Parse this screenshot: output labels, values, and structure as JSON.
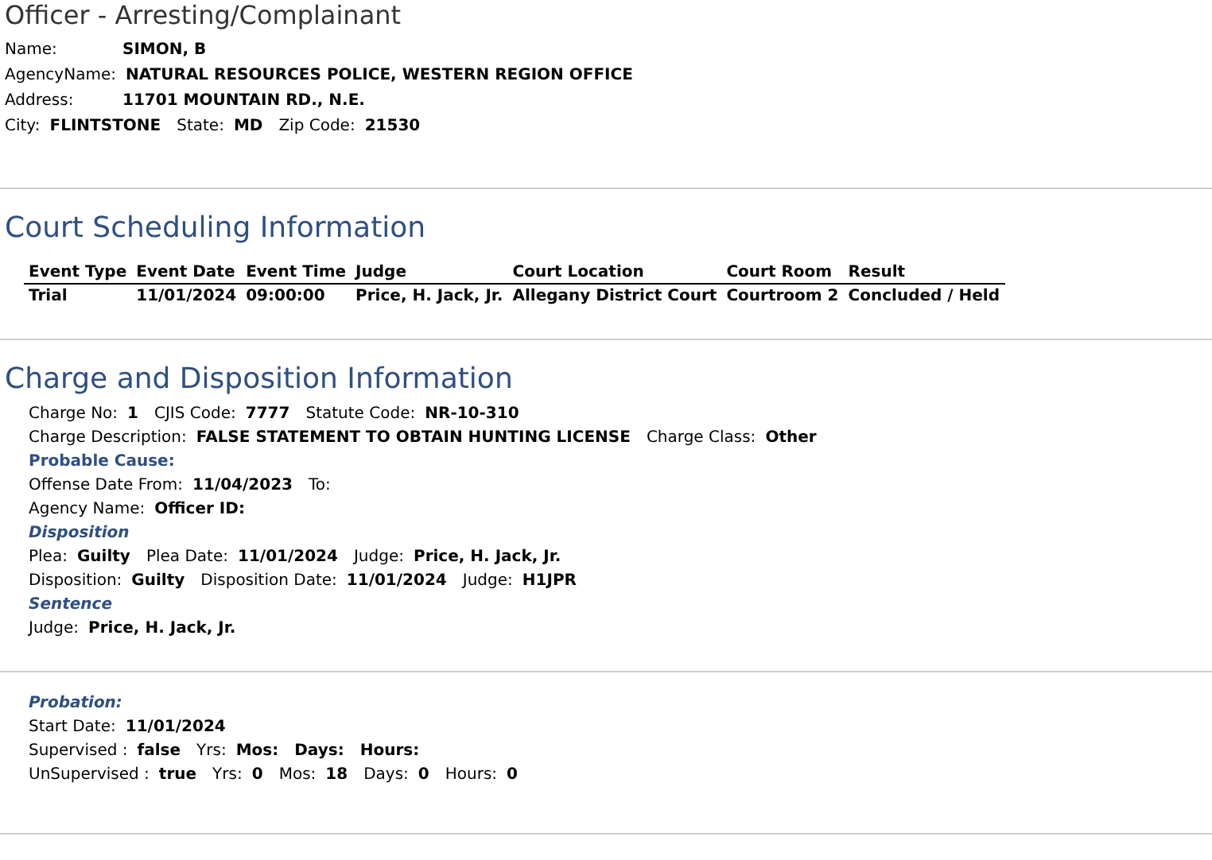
{
  "officer": {
    "title": "Officer - Arresting/Complainant",
    "lines": [
      [
        {
          "kind": "label",
          "text": "Name:"
        },
        {
          "kind": "value",
          "text": "SIMON, B"
        }
      ],
      [
        {
          "kind": "label",
          "text": "AgencyName:"
        },
        {
          "kind": "value",
          "text": "NATURAL RESOURCES POLICE, WESTERN REGION OFFICE"
        }
      ],
      [
        {
          "kind": "label",
          "text": "Address:"
        },
        {
          "kind": "value",
          "text": "11701 MOUNTAIN RD., N.E."
        }
      ],
      [
        {
          "kind": "label",
          "text": "City:"
        },
        {
          "kind": "value",
          "text": "FLINTSTONE"
        },
        {
          "kind": "label",
          "text": "State:"
        },
        {
          "kind": "value",
          "text": "MD"
        },
        {
          "kind": "label",
          "text": "Zip Code:"
        },
        {
          "kind": "value",
          "text": "21530"
        }
      ]
    ]
  },
  "court": {
    "title": "Court Scheduling Information",
    "columns": [
      "Event Type",
      "Event Date",
      "Event Time",
      "Judge",
      "Court Location",
      "Court Room",
      "Result"
    ],
    "rows": [
      [
        "Trial",
        "11/01/2024",
        "09:00:00",
        "Price, H. Jack, Jr.",
        "Allegany District Court",
        "Courtroom 2",
        "Concluded / Held"
      ]
    ]
  },
  "charge": {
    "title": "Charge and Disposition Information",
    "rows": [
      {
        "kind": "line",
        "parts": [
          {
            "kind": "label",
            "text": "Charge No:"
          },
          {
            "kind": "value",
            "text": "1"
          },
          {
            "kind": "label",
            "text": "CJIS Code:"
          },
          {
            "kind": "value",
            "text": "7777"
          },
          {
            "kind": "label",
            "text": "Statute Code:"
          },
          {
            "kind": "value",
            "text": "NR-10-310"
          }
        ]
      },
      {
        "kind": "line",
        "parts": [
          {
            "kind": "label",
            "text": "Charge Description:"
          },
          {
            "kind": "value",
            "text": "FALSE STATEMENT TO OBTAIN HUNTING LICENSE"
          },
          {
            "kind": "label",
            "text": "Charge Class:"
          },
          {
            "kind": "value",
            "text": "Other"
          }
        ]
      },
      {
        "kind": "heading",
        "text": "Probable Cause:"
      },
      {
        "kind": "line",
        "parts": [
          {
            "kind": "label",
            "text": "Offense Date From:"
          },
          {
            "kind": "value",
            "text": "11/04/2023"
          },
          {
            "kind": "label",
            "text": "To:"
          }
        ]
      },
      {
        "kind": "line",
        "parts": [
          {
            "kind": "label",
            "text": "Agency Name:"
          },
          {
            "kind": "value",
            "text": "Officer ID:"
          }
        ]
      },
      {
        "kind": "italic_heading",
        "text": "Disposition"
      },
      {
        "kind": "line",
        "parts": [
          {
            "kind": "label",
            "text": "Plea:"
          },
          {
            "kind": "value",
            "text": "Guilty"
          },
          {
            "kind": "label",
            "text": "Plea Date:"
          },
          {
            "kind": "value",
            "text": "11/01/2024"
          },
          {
            "kind": "label",
            "text": "Judge:"
          },
          {
            "kind": "value",
            "text": "Price, H. Jack, Jr."
          }
        ]
      },
      {
        "kind": "line",
        "parts": [
          {
            "kind": "label",
            "text": "Disposition:"
          },
          {
            "kind": "value",
            "text": "Guilty"
          },
          {
            "kind": "label",
            "text": "Disposition Date:"
          },
          {
            "kind": "value",
            "text": "11/01/2024"
          },
          {
            "kind": "label",
            "text": "Judge:"
          },
          {
            "kind": "value",
            "text": "H1JPR"
          }
        ]
      },
      {
        "kind": "italic_heading",
        "text": "Sentence"
      },
      {
        "kind": "line",
        "parts": [
          {
            "kind": "label",
            "text": "Judge:"
          },
          {
            "kind": "value",
            "text": "Price, H. Jack, Jr."
          }
        ]
      }
    ]
  },
  "probation": {
    "rows": [
      {
        "kind": "italic_heading",
        "text": "Probation:"
      },
      {
        "kind": "line",
        "parts": [
          {
            "kind": "label",
            "text": "Start Date:"
          },
          {
            "kind": "value",
            "text": "11/01/2024"
          }
        ]
      },
      {
        "kind": "line",
        "parts": [
          {
            "kind": "label",
            "text": "Supervised :"
          },
          {
            "kind": "value",
            "text": "false"
          },
          {
            "kind": "label",
            "text": "Yrs:"
          },
          {
            "kind": "value",
            "text": "Mos:"
          },
          {
            "kind": "value",
            "text": "Days:"
          },
          {
            "kind": "value",
            "text": "Hours:"
          }
        ]
      },
      {
        "kind": "line",
        "parts": [
          {
            "kind": "label",
            "text": "UnSupervised :"
          },
          {
            "kind": "value",
            "text": "true"
          },
          {
            "kind": "label",
            "text": "Yrs:"
          },
          {
            "kind": "value",
            "text": "0"
          },
          {
            "kind": "label",
            "text": "Mos:"
          },
          {
            "kind": "value",
            "text": "18"
          },
          {
            "kind": "label",
            "text": "Days:"
          },
          {
            "kind": "value",
            "text": "0"
          },
          {
            "kind": "label",
            "text": "Hours:"
          },
          {
            "kind": "value",
            "text": "0"
          }
        ]
      }
    ]
  }
}
